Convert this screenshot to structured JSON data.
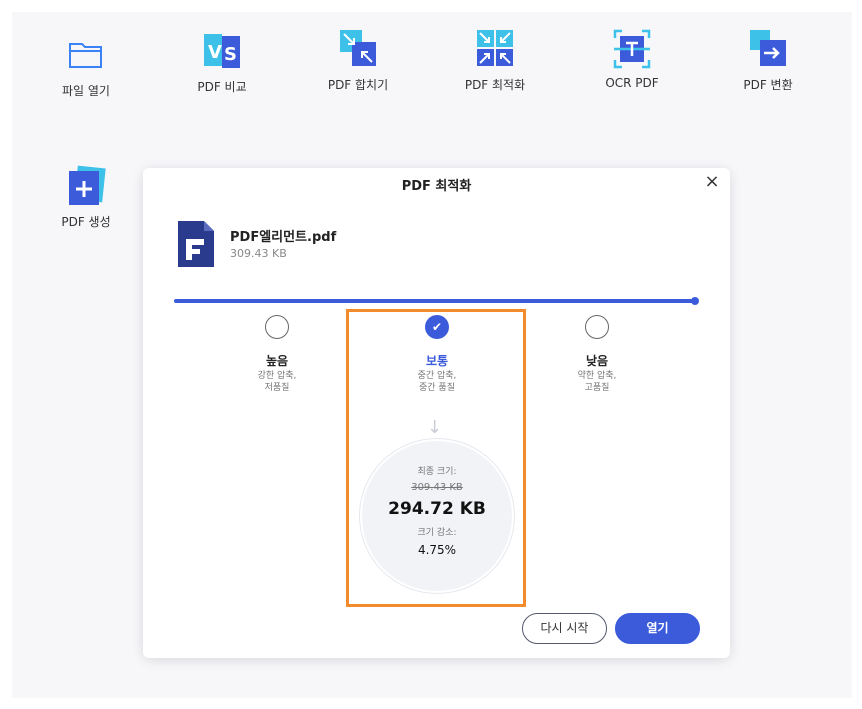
{
  "toolbar": {
    "tools": [
      {
        "label": "파일 열기",
        "icon": "folder-icon"
      },
      {
        "label": "PDF 비교",
        "icon": "compare-icon"
      },
      {
        "label": "PDF 합치기",
        "icon": "merge-icon"
      },
      {
        "label": "PDF 최적화",
        "icon": "optimize-icon"
      },
      {
        "label": "OCR PDF",
        "icon": "ocr-icon"
      },
      {
        "label": "PDF 변환",
        "icon": "convert-icon"
      },
      {
        "label": "PDF 생성",
        "icon": "create-pdf-icon"
      }
    ]
  },
  "dialog": {
    "title": "PDF 최적화",
    "file": {
      "name": "PDF엘리먼트.pdf",
      "size": "309.43 KB"
    },
    "options": [
      {
        "name": "높음",
        "desc1": "강한 압축,",
        "desc2": "저품질",
        "selected": false
      },
      {
        "name": "보통",
        "desc1": "중간 압축,",
        "desc2": "중간 품질",
        "selected": true
      },
      {
        "name": "낮음",
        "desc1": "약한 압축,",
        "desc2": "고품질",
        "selected": false
      }
    ],
    "result": {
      "final_size_label": "최종 크기:",
      "original_size": "309.43 KB",
      "final_size": "294.72 KB",
      "reduction_label": "크기 감소:",
      "reduction_pct": "4.75%"
    },
    "buttons": {
      "restart": "다시 시작",
      "open": "열기"
    }
  },
  "colors": {
    "accent": "#3b5bdb",
    "highlight": "#f28b2b"
  }
}
